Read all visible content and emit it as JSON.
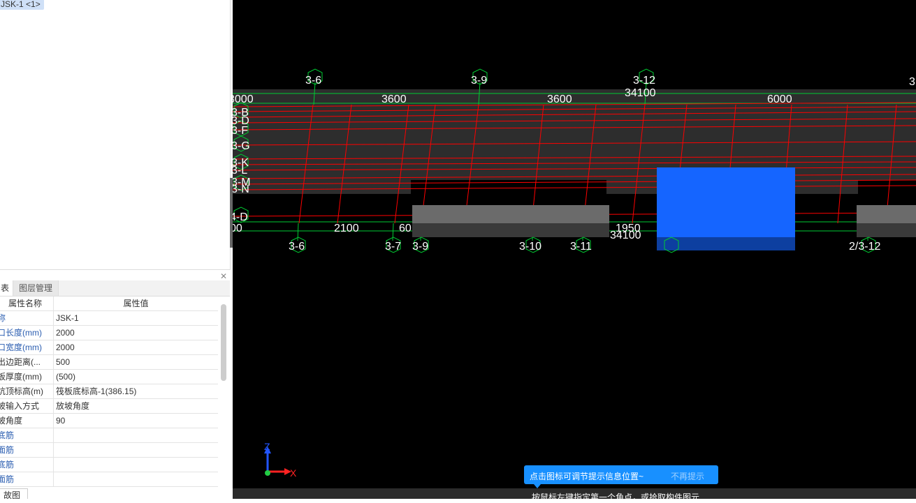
{
  "tree": {
    "selected_node": "JSK-1 <1>"
  },
  "tabs": {
    "properties_tab": "表",
    "layers_tab": "图层管理"
  },
  "grid": {
    "header_name": "属性名称",
    "header_value": "属性值",
    "rows": [
      {
        "name": "称",
        "value": "JSK-1",
        "blue": true
      },
      {
        "name": "口长度(mm)",
        "value": "2000",
        "blue": true
      },
      {
        "name": "口宽度(mm)",
        "value": "2000",
        "blue": true
      },
      {
        "name": "出边距离(...",
        "value": "500",
        "blue": false
      },
      {
        "name": "板厚度(mm)",
        "value": "(500)",
        "blue": false
      },
      {
        "name": "坑顶标高(m)",
        "value": "筏板底标高-1(386.15)",
        "blue": false
      },
      {
        "name": "坡输入方式",
        "value": "放坡角度",
        "blue": false
      },
      {
        "name": "坡角度",
        "value": "90",
        "blue": false
      },
      {
        "name": "底筋",
        "value": "",
        "blue": true
      },
      {
        "name": "面筋",
        "value": "",
        "blue": true
      },
      {
        "name": "底筋",
        "value": "",
        "blue": true
      },
      {
        "name": "面筋",
        "value": "",
        "blue": true
      }
    ]
  },
  "bottom_tab": "故图",
  "viewport": {
    "top_axes": [
      "3-6",
      "3-9",
      "3-12",
      "3"
    ],
    "top_dims": [
      "3000",
      "3600",
      "3600",
      "6000"
    ],
    "top_total": "34100",
    "row_labels": [
      "3-B",
      "3-D",
      "3-F",
      "3-G",
      "3-K",
      "3-L",
      "3-M",
      "3-N",
      "4-D"
    ],
    "bottom_axes": [
      "3-6",
      "3-7",
      "3-9",
      "3-10",
      "3-11",
      "2/3-12"
    ],
    "bottom_dims": [
      "00",
      "2100",
      "60",
      "1950"
    ],
    "bottom_total": "34100",
    "axis_x": "X",
    "axis_z": "Z"
  },
  "tooltip": {
    "text": "点击图标可调节提示信息位置~",
    "link": "不再提示"
  },
  "status": {
    "text": "按鼠标左键指定第一个角点，或拾取构件图元"
  },
  "colors": {
    "selected_block": "#1565ff",
    "grid_line": "#ff0000",
    "axis_line": "#00cc33",
    "tooltip_bg": "#1890ff"
  }
}
